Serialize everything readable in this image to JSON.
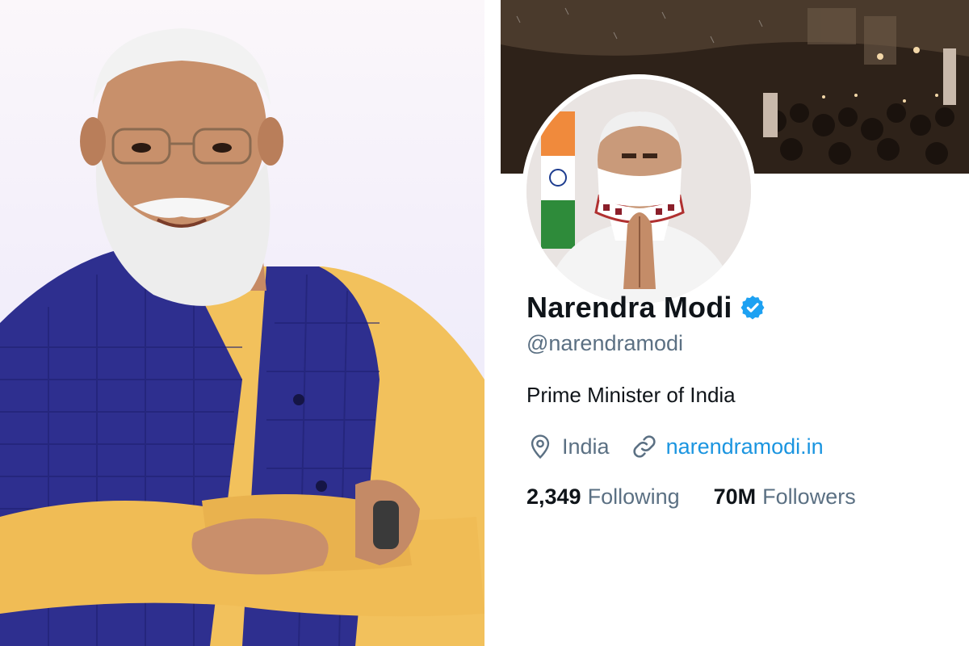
{
  "profile": {
    "display_name": "Narendra Modi",
    "handle": "@narendramodi",
    "bio": "Prime Minister of India",
    "location": "India",
    "website": "narendramodi.in",
    "stats": {
      "following_count": "2,349",
      "following_label": "Following",
      "followers_count": "70M",
      "followers_label": "Followers"
    }
  },
  "icons": {
    "verified": "verified-badge-icon",
    "location": "location-pin-icon",
    "link": "link-icon"
  },
  "colors": {
    "verified_blue": "#1da1f2",
    "link_blue": "#1b95e0",
    "secondary_text": "#5b7083",
    "primary_text": "#0f1419"
  }
}
